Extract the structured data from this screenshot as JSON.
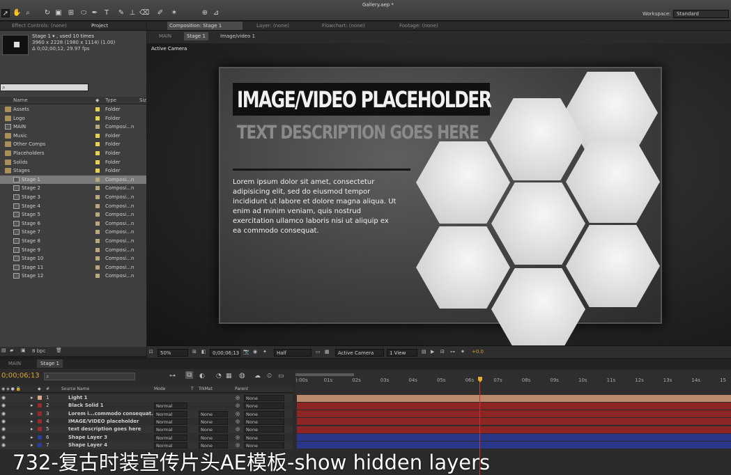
{
  "window": {
    "title": "Gallery.aep *"
  },
  "toolbar": {
    "workspace_label": "Workspace:",
    "workspace_value": "Standard"
  },
  "project_panel": {
    "tabs": [
      "Effect Controls: (none)",
      "Project"
    ],
    "item_name": "Stage 1 ▾ , used 10 times",
    "item_dims": "3960 x 2228  (1980 x 1114) (1.00)",
    "item_duration": "Δ 0;02;00;12, 29.97 fps",
    "columns": {
      "name": "Name",
      "type": "Type",
      "size": "Siz"
    },
    "items": [
      {
        "name": "Assets",
        "type": "Folder",
        "kind": "folder",
        "swatch": "#e8d44a"
      },
      {
        "name": "Logo",
        "type": "Folder",
        "kind": "folder",
        "swatch": "#e8d44a"
      },
      {
        "name": "MAIN",
        "type": "Composi...n",
        "kind": "comp",
        "swatch": "#b9a878"
      },
      {
        "name": "Music",
        "type": "Folder",
        "kind": "folder",
        "swatch": "#e8d44a"
      },
      {
        "name": "Other Comps",
        "type": "Folder",
        "kind": "folder",
        "swatch": "#e8d44a"
      },
      {
        "name": "Placeholders",
        "type": "Folder",
        "kind": "folder",
        "swatch": "#e8d44a"
      },
      {
        "name": "Solids",
        "type": "Folder",
        "kind": "folder",
        "swatch": "#e8d44a"
      },
      {
        "name": "Stages",
        "type": "Folder",
        "kind": "folder",
        "swatch": "#e8d44a"
      },
      {
        "name": "Stage 1",
        "type": "Composi...n",
        "kind": "comp",
        "swatch": "#b9a878",
        "selected": true
      },
      {
        "name": "Stage 2",
        "type": "Composi...n",
        "kind": "comp",
        "swatch": "#b9a878"
      },
      {
        "name": "Stage 3",
        "type": "Composi...n",
        "kind": "comp",
        "swatch": "#b9a878"
      },
      {
        "name": "Stage 4",
        "type": "Composi...n",
        "kind": "comp",
        "swatch": "#b9a878"
      },
      {
        "name": "Stage 5",
        "type": "Composi...n",
        "kind": "comp",
        "swatch": "#b9a878"
      },
      {
        "name": "Stage 6",
        "type": "Composi...n",
        "kind": "comp",
        "swatch": "#b9a878"
      },
      {
        "name": "Stage 7",
        "type": "Composi...n",
        "kind": "comp",
        "swatch": "#b9a878"
      },
      {
        "name": "Stage 8",
        "type": "Composi...n",
        "kind": "comp",
        "swatch": "#b9a878"
      },
      {
        "name": "Stage 9",
        "type": "Composi...n",
        "kind": "comp",
        "swatch": "#b9a878"
      },
      {
        "name": "Stage 10",
        "type": "Composi...n",
        "kind": "comp",
        "swatch": "#b9a878"
      },
      {
        "name": "Stage 11",
        "type": "Composi...n",
        "kind": "comp",
        "swatch": "#b9a878"
      },
      {
        "name": "Stage 12",
        "type": "Composi...n",
        "kind": "comp",
        "swatch": "#b9a878"
      }
    ],
    "bpc": "8 bpc"
  },
  "comp_panel": {
    "tabs": [
      "Composition: Stage 1",
      "Layer: (none)",
      "Flowchart: (none)",
      "Footage: (none)"
    ],
    "breadcrumbs": [
      "MAIN",
      "Stage 1",
      "Image/video 1"
    ],
    "camera_label": "Active Camera",
    "slide": {
      "heading": "IMAGE/VIDEO PLACEHOLDER",
      "subheading": "TEXT DESCRIPTION GOES HERE",
      "body": "Lorem ipsum dolor sit amet, consectetur adipisicing elit, sed do eiusmod tempor incididunt ut labore et dolore magna aliqua. Ut enim ad minim veniam, quis nostrud exercitation ullamco laboris nisi ut aliquip ex ea commodo consequat."
    },
    "viewer_bar": {
      "zoom": "50%",
      "timecode": "0;00;06;13",
      "resolution": "Half",
      "camera": "Active Camera",
      "views": "1 View",
      "exposure": "+0.0"
    }
  },
  "timeline": {
    "tabs": [
      "MAIN",
      "Stage 1"
    ],
    "current_time": "0;00;06;13",
    "columns": {
      "source": "Source Name",
      "mode": "Mode",
      "t": "T",
      "trkmat": "TrkMat",
      "parent": "Parent"
    },
    "ruler": [
      "):00s",
      "01s",
      "02s",
      "03s",
      "04s",
      "05s",
      "06s",
      "07s",
      "08s",
      "09s",
      "10s",
      "11s",
      "12s",
      "13s",
      "14s",
      "15"
    ],
    "layers": [
      {
        "num": "1",
        "name": "Light 1",
        "mode": "",
        "trkmat": "",
        "parent": "None",
        "color": "#d9a78a",
        "bar": "#b98a6c"
      },
      {
        "num": "2",
        "name": "Black Solid 1",
        "mode": "Normal",
        "trkmat": "",
        "parent": "None",
        "color": "#9a2b2b",
        "bar": "#8e2525"
      },
      {
        "num": "3",
        "name": "Lorem i...commodo consequat.",
        "mode": "Normal",
        "trkmat": "None",
        "parent": "None",
        "color": "#9a2b2b",
        "bar": "#8e2525"
      },
      {
        "num": "4",
        "name": "IMAGE/VIDEO placeholder",
        "mode": "Normal",
        "trkmat": "None",
        "parent": "None",
        "color": "#9a2b2b",
        "bar": "#8e2525"
      },
      {
        "num": "5",
        "name": "text description goes here",
        "mode": "Normal",
        "trkmat": "None",
        "parent": "None",
        "color": "#9a2b2b",
        "bar": "#8e2525"
      },
      {
        "num": "6",
        "name": "Shape Layer 3",
        "mode": "Normal",
        "trkmat": "None",
        "parent": "None",
        "color": "#2a3f9a",
        "bar": "#2a3688"
      },
      {
        "num": "7",
        "name": "Shape Layer 4",
        "mode": "Normal",
        "trkmat": "None",
        "parent": "None",
        "color": "#2a3f9a",
        "bar": "#2a3688"
      }
    ]
  },
  "caption": "732-复古时装宣传片头AE模板-show hidden layers"
}
